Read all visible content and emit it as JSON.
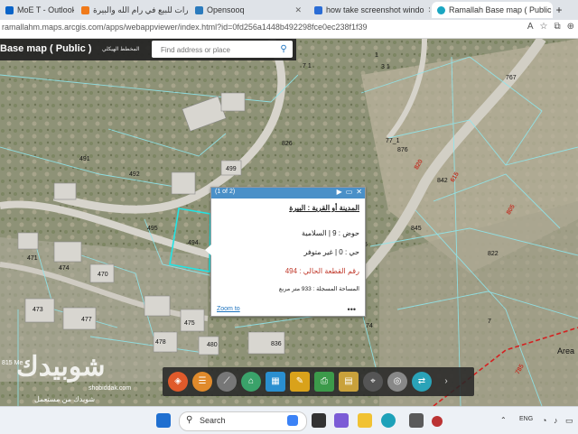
{
  "tabs": [
    {
      "label": "MoE T - Outlook",
      "color": "#0a64c8"
    },
    {
      "label": "عقارات للبيع في رام الله والبيرة",
      "color": "#f07a1a"
    },
    {
      "label": "Opensooq",
      "color": "#2b7bbd"
    },
    {
      "label": "how take screenshot windo",
      "color": "#2a6cd5"
    },
    {
      "label": "Ramallah Base map ( Public",
      "color": "#1aa6c2"
    }
  ],
  "window": {
    "min": "—",
    "max": "▢",
    "close": "✕"
  },
  "address": {
    "url": "ramallahm.maps.arcgis.com/apps/webappviewer/index.html?id=0fd256a1448b492298fce0ec238f1f39"
  },
  "app": {
    "title": "Base map ( Public )",
    "subtitle": "المخطط الهيكلي",
    "search_placeholder": "Find address or place"
  },
  "popup": {
    "counter": "(1 of 2)",
    "line1": "المدينة أو القرية : البيرة",
    "line2": "حوض : 9 | السلامية",
    "line3": "حي : 0 | غير متوفر",
    "line4": "رقم القطعة الحالي : 494",
    "line5": "المساحة المسجلة : 933 متر مربع",
    "zoom": "Zoom to",
    "more": "•••"
  },
  "parcels": [
    "1",
    "3 1",
    "767",
    "7 1",
    "77_1",
    "826",
    "876",
    "842",
    "845",
    "822",
    "491",
    "492",
    "499",
    "495",
    "494",
    "471",
    "474",
    "470",
    "473",
    "477",
    "478",
    "475",
    "480",
    "836",
    "74",
    "7",
    "5"
  ],
  "roads": [
    "820",
    "615",
    "805",
    "785"
  ],
  "map_misc": {
    "area": "Area",
    "scale": "815 Me"
  },
  "watermark": {
    "logo": "شوبيدك",
    "url": "shobiddak.com",
    "tagline": "شوبدك من مستعمل"
  },
  "taskbar": {
    "search": "Search",
    "lang": "ENG"
  },
  "colors": {
    "accent": "#1e73be",
    "popup_header": "#4a90c8",
    "parcel_red": "#c0392b"
  }
}
